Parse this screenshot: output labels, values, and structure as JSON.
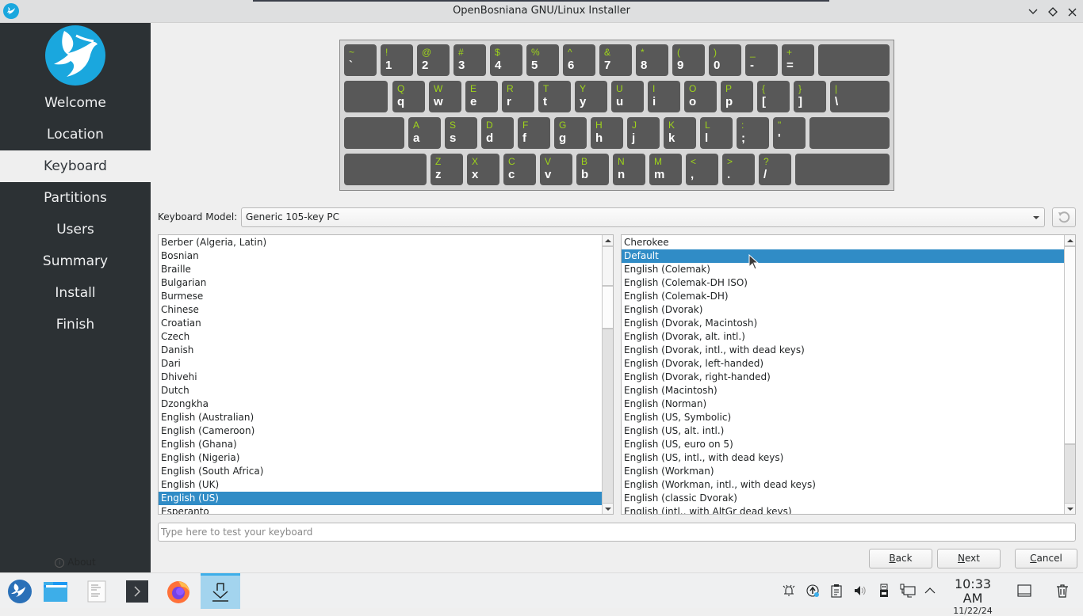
{
  "window": {
    "title": "OpenBosniana GNU/Linux Installer",
    "controls": [
      "minimize",
      "maximize",
      "close"
    ]
  },
  "sidebar": {
    "items": [
      {
        "label": "Welcome",
        "active": false
      },
      {
        "label": "Location",
        "active": false
      },
      {
        "label": "Keyboard",
        "active": true
      },
      {
        "label": "Partitions",
        "active": false
      },
      {
        "label": "Users",
        "active": false
      },
      {
        "label": "Summary",
        "active": false
      },
      {
        "label": "Install",
        "active": false
      },
      {
        "label": "Finish",
        "active": false
      }
    ],
    "about_label": "About"
  },
  "keyboard_preview": {
    "colors": {
      "shift_label": "#9fd51a",
      "base_label": "#ffffff",
      "key": "#585858",
      "background": "#d7d7d7"
    },
    "rows": [
      [
        [
          "~",
          "`"
        ],
        [
          "!",
          "1"
        ],
        [
          "@",
          "2"
        ],
        [
          "#",
          "3"
        ],
        [
          "$",
          "4"
        ],
        [
          "%",
          "5"
        ],
        [
          "^",
          "6"
        ],
        [
          "&",
          "7"
        ],
        [
          "*",
          "8"
        ],
        [
          "(",
          "9"
        ],
        [
          ")",
          "0"
        ],
        [
          "_",
          "-"
        ],
        [
          "+",
          "="
        ],
        [
          "",
          ""
        ]
      ],
      [
        [
          "",
          ""
        ],
        [
          "Q",
          "q"
        ],
        [
          "W",
          "w"
        ],
        [
          "E",
          "e"
        ],
        [
          "R",
          "r"
        ],
        [
          "T",
          "t"
        ],
        [
          "Y",
          "y"
        ],
        [
          "U",
          "u"
        ],
        [
          "I",
          "i"
        ],
        [
          "O",
          "o"
        ],
        [
          "P",
          "p"
        ],
        [
          "{",
          "["
        ],
        [
          "}",
          "]"
        ],
        [
          "|",
          "\\"
        ]
      ],
      [
        [
          "",
          ""
        ],
        [
          "A",
          "a"
        ],
        [
          "S",
          "s"
        ],
        [
          "D",
          "d"
        ],
        [
          "F",
          "f"
        ],
        [
          "G",
          "g"
        ],
        [
          "H",
          "h"
        ],
        [
          "J",
          "j"
        ],
        [
          "K",
          "k"
        ],
        [
          "L",
          "l"
        ],
        [
          ":",
          ";"
        ],
        [
          "\"",
          "'"
        ],
        [
          "",
          ""
        ]
      ],
      [
        [
          "",
          ""
        ],
        [
          "Z",
          "z"
        ],
        [
          "X",
          "x"
        ],
        [
          "C",
          "c"
        ],
        [
          "V",
          "v"
        ],
        [
          "B",
          "b"
        ],
        [
          "N",
          "n"
        ],
        [
          "M",
          "m"
        ],
        [
          "<",
          ","
        ],
        [
          ">",
          "."
        ],
        [
          "?",
          "/"
        ],
        [
          "",
          ""
        ]
      ]
    ]
  },
  "model": {
    "label": "Keyboard Model:",
    "value": "Generic 105-key PC",
    "revert_icon": "revert-icon"
  },
  "layouts": {
    "items": [
      "Berber (Algeria, Latin)",
      "Bosnian",
      "Braille",
      "Bulgarian",
      "Burmese",
      "Chinese",
      "Croatian",
      "Czech",
      "Danish",
      "Dari",
      "Dhivehi",
      "Dutch",
      "Dzongkha",
      "English (Australian)",
      "English (Cameroon)",
      "English (Ghana)",
      "English (Nigeria)",
      "English (South Africa)",
      "English (UK)",
      "English (US)",
      "Esperanto"
    ],
    "selected": "English (US)"
  },
  "variants": {
    "items": [
      "Cherokee",
      "Default",
      "English (Colemak)",
      "English (Colemak-DH ISO)",
      "English (Colemak-DH)",
      "English (Dvorak)",
      "English (Dvorak, Macintosh)",
      "English (Dvorak, alt. intl.)",
      "English (Dvorak, intl., with dead keys)",
      "English (Dvorak, left-handed)",
      "English (Dvorak, right-handed)",
      "English (Macintosh)",
      "English (Norman)",
      "English (US, Symbolic)",
      "English (US, alt. intl.)",
      "English (US, euro on 5)",
      "English (US, intl., with dead keys)",
      "English (Workman)",
      "English (Workman, intl., with dead keys)",
      "English (classic Dvorak)",
      "English (intl., with AltGr dead keys)"
    ],
    "selected": "Default"
  },
  "test_input": {
    "placeholder": "Type here to test your keyboard",
    "value": ""
  },
  "buttons": {
    "back": {
      "mnemonic": "B",
      "rest": "ack"
    },
    "next": {
      "mnemonic": "N",
      "rest": "ext"
    },
    "cancel": {
      "mnemonic": "C",
      "rest": "ancel"
    }
  },
  "taskbar": {
    "apps": [
      "start-menu",
      "file-manager",
      "text-editor",
      "terminal",
      "firefox",
      "installer"
    ],
    "active_app": "installer",
    "tray": [
      "notifications-icon",
      "updates-icon",
      "clipboard-icon",
      "volume-icon",
      "usb-device-icon",
      "network-icon",
      "expand-tray-icon"
    ],
    "time": "10:33 AM",
    "date": "11/22/24"
  },
  "accent_color": "#308cc6"
}
